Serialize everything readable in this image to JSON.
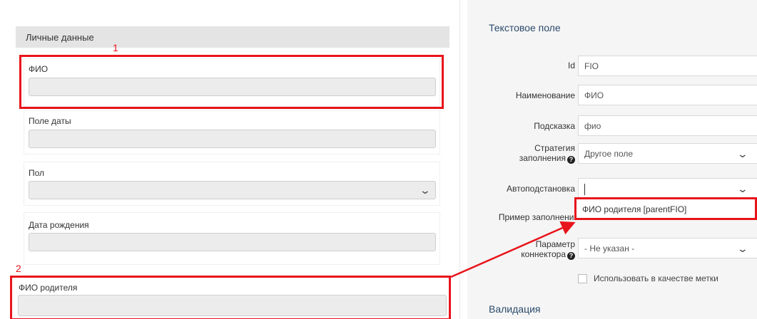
{
  "form": {
    "section_title": "Личные данные",
    "fields": [
      {
        "label": "ФИО"
      },
      {
        "label": "Поле даты"
      },
      {
        "label": "Пол"
      },
      {
        "label": "Дата рождения"
      }
    ],
    "parent_field_label": "ФИО родителя"
  },
  "annotations": {
    "marker1": "1",
    "marker2": "2",
    "color": "#e8141b"
  },
  "props": {
    "title": "Текстовое поле",
    "id_label": "Id",
    "id_value": "FIO",
    "name_label": "Наименование",
    "name_value": "ФИО",
    "hint_label": "Подсказка",
    "hint_value": "фио",
    "strategy_label_1": "Стратегия",
    "strategy_label_2": "заполнения",
    "strategy_value": "Другое поле",
    "autofill_label": "Автоподстановка",
    "autofill_option": "ФИО родителя [parentFIO]",
    "example_label": "Пример заполнения",
    "connector_label_1": "Параметр",
    "connector_label_2": "коннектора",
    "connector_value": "- Не указан -",
    "use_as_label": "Использовать в качестве метки",
    "validation_title": "Валидация"
  }
}
